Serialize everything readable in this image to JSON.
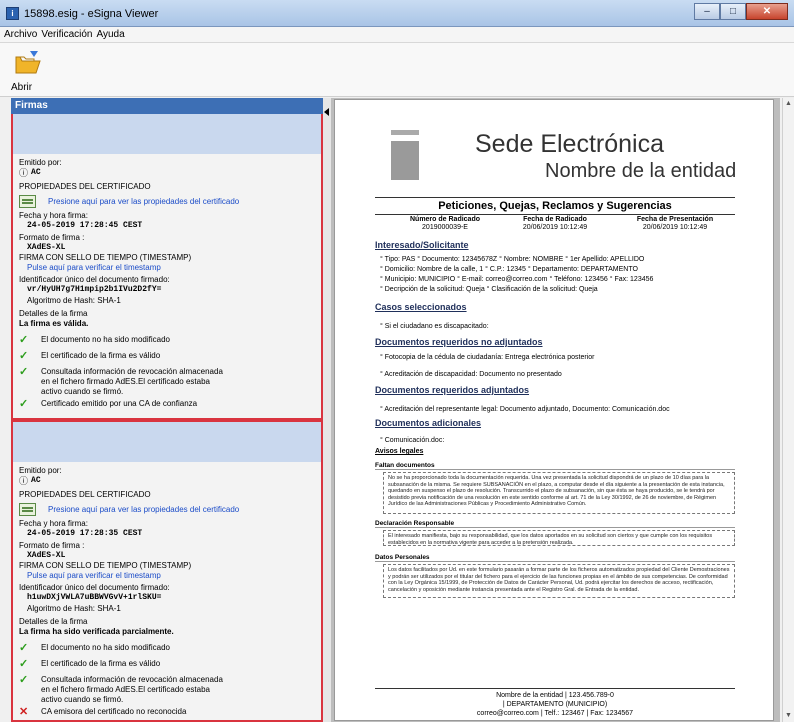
{
  "window": {
    "title": "15898.esig - eSigna Viewer",
    "minimize": "–",
    "maximize": "□",
    "close": "✕"
  },
  "menu": [
    "Archivo",
    "Verificación",
    "Ayuda"
  ],
  "toolbar": {
    "open_label": "Abrir"
  },
  "panel": {
    "header": "Firmas"
  },
  "signatures": [
    {
      "issued_by_label": "Emitido por:",
      "issuer": "AC",
      "props_label": "PROPIEDADES DEL CERTIFICADO",
      "props_link": "Presione aquí para ver las propiedades del certificado",
      "datetime_label": "Fecha y hora firma:",
      "datetime": "24-05-2019 17:28:45 CEST",
      "format_label": "Formato de firma :",
      "format": "XAdES-XL",
      "timestamp_label": "FIRMA CON SELLO DE TIEMPO (TIMESTAMP)",
      "timestamp_link": "Pulse aquí para verificar el timestamp",
      "id_label": "Identificador único del documento firmado:",
      "id": "vr/HyUH7g7H1mpip2b1IVu2D2fY=",
      "hash": "Algoritmo de Hash: SHA-1",
      "details_label": "Detalles de la firma",
      "status": "La firma es válida.",
      "checks": [
        {
          "ok": true,
          "text": "El documento no ha sido modificado"
        },
        {
          "ok": true,
          "text": "El certificado de la firma es válido"
        },
        {
          "ok": true,
          "text": "Consultada información de revocación almacenada en el fichero firmado AdES.El certificado estaba activo cuando se firmó."
        },
        {
          "ok": true,
          "text": "Certificado emitido por una CA de confianza"
        }
      ]
    },
    {
      "issued_by_label": "Emitido por:",
      "issuer": "AC",
      "props_label": "PROPIEDADES DEL CERTIFICADO",
      "props_link": "Presione aquí para ver las propiedades del certificado",
      "datetime_label": "Fecha y hora firma:",
      "datetime": "24-05-2019 17:28:35 CEST",
      "format_label": "Formato de firma :",
      "format": "XAdES-XL",
      "timestamp_label": "FIRMA CON SELLO DE TIEMPO (TIMESTAMP)",
      "timestamp_link": "Pulse aquí para verificar el timestamp",
      "id_label": "Identificador único del documento firmado:",
      "id": "h1uwDXjVWLA7uBBWVGvV+1rlSKU=",
      "hash": "Algoritmo de Hash: SHA-1",
      "details_label": "Detalles de la firma",
      "status": "La firma ha sido verificada parcialmente.",
      "checks": [
        {
          "ok": true,
          "text": "El documento no ha sido modificado"
        },
        {
          "ok": true,
          "text": "El certificado de la firma es válido"
        },
        {
          "ok": true,
          "text": "Consultada información de revocación almacenada en el fichero firmado AdES.El certificado estaba activo cuando se firmó."
        },
        {
          "ok": false,
          "text": "CA emisora del certificado no reconocida"
        }
      ]
    }
  ],
  "doc": {
    "sede": "Sede Electrónica",
    "entidad": "Nombre de la entidad",
    "pqrs": "Peticiones, Quejas, Reclamos y Sugerencias",
    "rad": [
      {
        "label": "Número de Radicado",
        "value": "2019000039-E"
      },
      {
        "label": "Fecha de Radicado",
        "value": "20/06/2019 10:12:49"
      },
      {
        "label": "Fecha de Presentación",
        "value": "20/06/2019 10:12:49"
      }
    ],
    "interesado_title": "Interesado/Solicitante",
    "l1": "° Tipo: PAS    ° Documento: 12345678Z    ° Nombre: NOMBRE    ° 1er Apellido: APELLIDO",
    "l2": "° Domicilio: Nombre de la calle, 1   ° C.P.: 12345    ° Departamento: DEPARTAMENTO",
    "l3": "° Municipio: MUNICIPIO    ° E-mail: correo@correo.com    ° Teléfono: 123456    ° Fax: 123456",
    "l4": "° Decripción de la solicitud: Queja    ° Clasificación de la solicitud: Queja",
    "casos_title": "Casos seleccionados",
    "casos": "° Si el ciudadano es discapacitado:",
    "noadj_title": "Documentos requeridos no adjuntados",
    "noadj1": "° Fotocopia de la cédula de ciudadanía: Entrega electrónica posterior",
    "noadj2": "° Acreditación de discapacidad: Documento no presentado",
    "adj_title": "Documentos requeridos adjuntados",
    "adj1": "° Acreditación del representante legal: Documento adjuntado, Documento: Comunicación.doc",
    "adic_title": "Documentos adicionales",
    "adic1": "° Comunicación.doc:",
    "avisos": "Avisos legales",
    "faltan_title": "Faltan documentos",
    "faltan_text": "No se ha proporcionado toda la documentación requerida. Una vez presentada la solicitud dispondrá de un plazo de 10 días para la subsanación de la misma. Se requiere SUBSANACIÓN en el plazo, a computar desde el día siguiente a la presentación de esta instancia, quedando en suspenso el plazo de resolución. Transcurrido el plazo de subsanación, sin que ésta se haya producido, se le tendrá por desistido previa notificación de una resolución en este sentido conforme al art. 71 de la Ley 30/1992, de 26 de noviembre, de Régimen Jurídico de las Administraciones Públicas y Procedimiento Administrativo Común.",
    "decl_title": "Declaración Responsable",
    "decl_text": "El interesado manifiesta, bajo su responsabilidad, que los datos aportados en su solicitud son ciertos y que cumple con los requisitos establecidos en la normativa vigente para acceder a la pretensión realizada.",
    "datos_title": "Datos Personales",
    "datos_text": "Los datos facilitados por Ud. en este formulario pasarán a formar parte de los ficheros automatizados propiedad del Cliente Demostraciones y podrán ser utilizados por el titular del fichero para el ejercicio de las funciones propias en el ámbito de sus competencias. De conformidad con la Ley Orgánica 15/1999, de Protección de Datos de Carácter Personal, Ud. podrá ejercitar los derechos de acceso, rectificación, cancelación y oposición mediante instancia presentada ante el Registro Gral. de Entrada de la entidad.",
    "footer1": "Nombre de la entidad | 123.456.789-0",
    "footer2": "| DEPARTAMENTO (MUNICIPIO)",
    "footer3": "correo@correo.com | Telf.: 123467 | Fax: 1234567"
  }
}
